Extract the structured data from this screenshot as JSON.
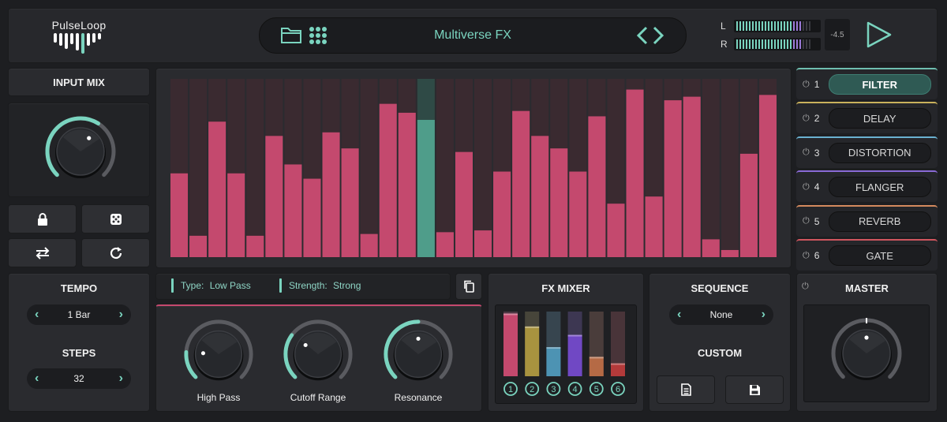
{
  "brand": {
    "name": "PulseLoop"
  },
  "preset": {
    "name": "Multiverse FX"
  },
  "meter": {
    "left_label": "L",
    "right_label": "R",
    "db_value": "-4.5"
  },
  "input_mix": {
    "title": "INPUT MIX",
    "level": 0.62
  },
  "sequencer": {
    "values": [
      0.47,
      0.12,
      0.76,
      0.47,
      0.12,
      0.68,
      0.52,
      0.44,
      0.7,
      0.61,
      0.13,
      0.86,
      0.81,
      0.77,
      0.14,
      0.59,
      0.15,
      0.48,
      0.82,
      0.68,
      0.61,
      0.48,
      0.79,
      0.3,
      0.94,
      0.34,
      0.88,
      0.9,
      0.1,
      0.04,
      0.58,
      0.91
    ],
    "active_step": 13,
    "bar_color": "#c4496e",
    "active_color": "#4f9d8a"
  },
  "filter_info": {
    "type_label": "Type:",
    "type_value": "Low Pass",
    "strength_label": "Strength:",
    "strength_value": "Strong"
  },
  "tempo": {
    "title": "TEMPO",
    "value": "1 Bar"
  },
  "steps": {
    "title": "STEPS",
    "value": "32"
  },
  "knobs": [
    {
      "label": "High Pass",
      "value": 0.18
    },
    {
      "label": "Cutoff Range",
      "value": 0.3
    },
    {
      "label": "Resonance",
      "value": 0.5
    }
  ],
  "fx_mixer": {
    "title": "FX MIXER",
    "channels": [
      {
        "num": "1",
        "level": 0.97,
        "color": "#c4496e"
      },
      {
        "num": "2",
        "level": 0.77,
        "color": "#a8933f"
      },
      {
        "num": "3",
        "level": 0.45,
        "color": "#4d93b3"
      },
      {
        "num": "4",
        "level": 0.64,
        "color": "#7048c4"
      },
      {
        "num": "5",
        "level": 0.3,
        "color": "#b56a45"
      },
      {
        "num": "6",
        "level": 0.2,
        "color": "#b33a3a"
      }
    ]
  },
  "sequence": {
    "title": "SEQUENCE",
    "value": "None",
    "custom_title": "CUSTOM"
  },
  "master": {
    "title": "MASTER",
    "level": 0.5
  },
  "fx_chain": [
    {
      "num": "1",
      "name": "FILTER",
      "color": "#6fbfb0",
      "active": true
    },
    {
      "num": "2",
      "name": "DELAY",
      "color": "#c9b15c"
    },
    {
      "num": "3",
      "name": "DISTORTION",
      "color": "#6ab1d0"
    },
    {
      "num": "4",
      "name": "FLANGER",
      "color": "#8a6ad6"
    },
    {
      "num": "5",
      "name": "REVERB",
      "color": "#d48a5e"
    },
    {
      "num": "6",
      "name": "GATE",
      "color": "#d0555e"
    }
  ],
  "colors": {
    "accent": "#7ad4bf",
    "bar": "#c4496e"
  }
}
